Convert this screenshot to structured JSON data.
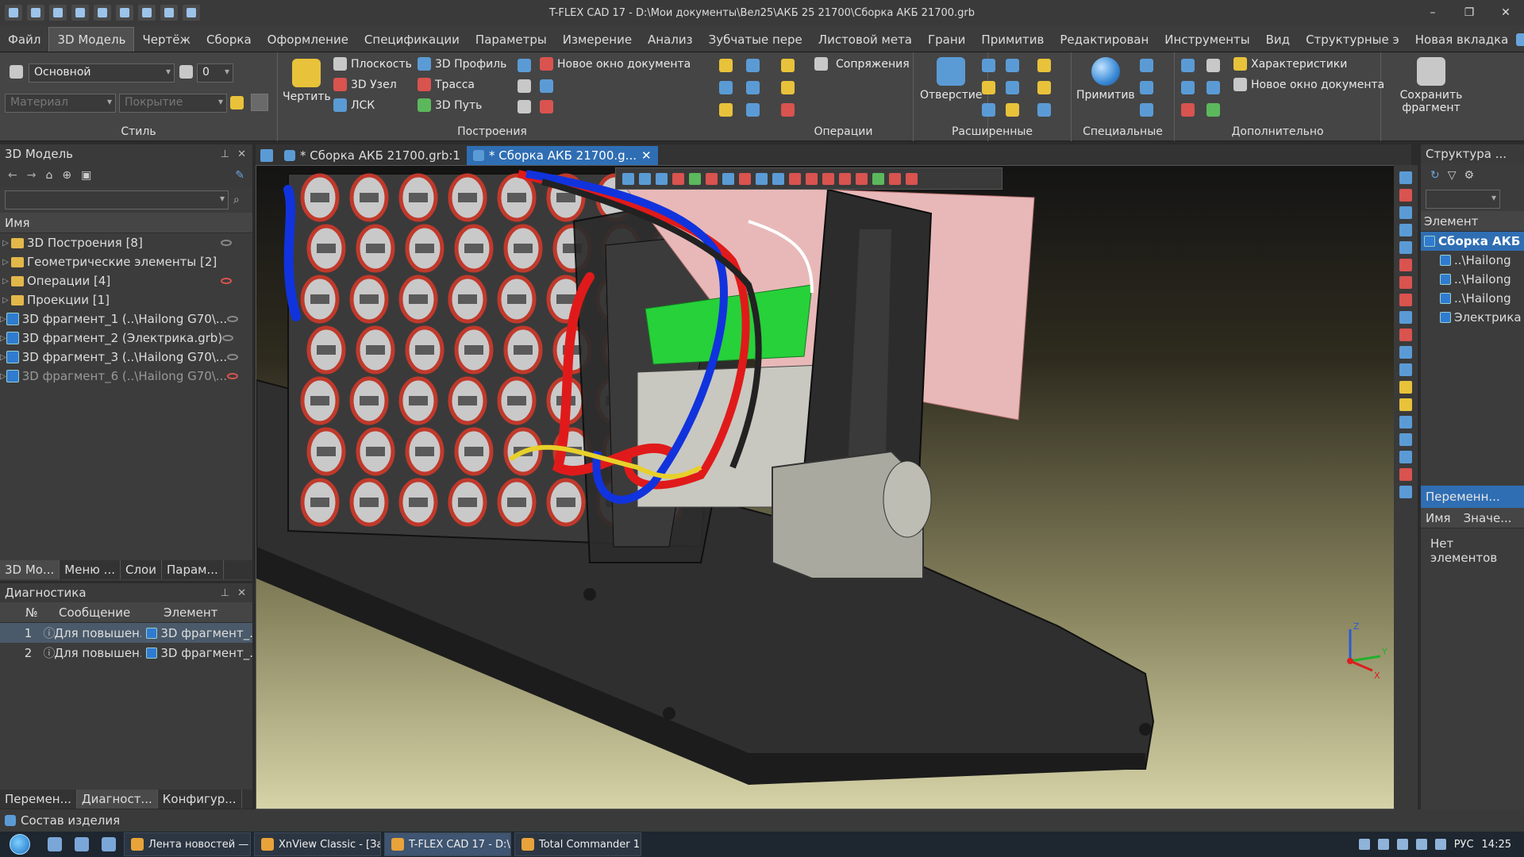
{
  "window": {
    "title": "T-FLEX CAD 17 - D:\\Мои документы\\Вел25\\АКБ 25 21700\\Сборка АКБ 21700.grb",
    "minimize": "–",
    "restore": "❐",
    "close": "✕"
  },
  "menu": {
    "tabs": [
      "Файл",
      "3D Модель",
      "Чертёж",
      "Сборка",
      "Оформление",
      "Спецификации",
      "Параметры",
      "Измерение",
      "Анализ",
      "Зубчатые пере",
      "Листовой мета",
      "Грани",
      "Примитив",
      "Редактирован",
      "Инструменты",
      "Вид",
      "Структурные э",
      "Новая вкладка"
    ],
    "active_index": 1
  },
  "ribbon": {
    "style": {
      "group_name": "Стиль",
      "layer_value": "Основной",
      "level_value": "0",
      "material_placeholder": "Материал",
      "coating_placeholder": "Покрытие"
    },
    "build": {
      "group_name": "Построения",
      "draw_label": "Чертить",
      "plane": "Плоскость",
      "node3d": "3D Узел",
      "lsk": "ЛСК",
      "profile3d": "3D Профиль",
      "route": "Трасса",
      "path3d": "3D Путь",
      "new_window": "Новое окно документа"
    },
    "operations": {
      "group_name": "Операции",
      "mates": "Сопряжения"
    },
    "extended": {
      "group_name": "Расширенные",
      "hole": "Отверстие"
    },
    "special": {
      "group_name": "Специальные",
      "primitive": "Примитив"
    },
    "additional": {
      "group_name": "Дополнительно",
      "characteristics": "Характеристики",
      "new_window": "Новое окно документа",
      "save_fragment": "Сохранить фрагмент"
    }
  },
  "model_panel": {
    "title": "3D Модель",
    "column": "Имя",
    "items": [
      {
        "label": "3D Построения [8]",
        "type": "folder",
        "eye": "on"
      },
      {
        "label": "Геометрические элементы [2]",
        "type": "folder",
        "eye": ""
      },
      {
        "label": "Операции [4]",
        "type": "folder",
        "eye": "hidden"
      },
      {
        "label": "Проекции [1]",
        "type": "folder",
        "eye": ""
      },
      {
        "label": "3D фрагмент_1 (..\\Hailong G70\\...",
        "type": "fragment",
        "eye": "on"
      },
      {
        "label": "3D фрагмент_2 (Электрика.grb)",
        "type": "fragment",
        "eye": "on"
      },
      {
        "label": "3D фрагмент_3 (..\\Hailong G70\\...",
        "type": "fragment",
        "eye": "on"
      },
      {
        "label": "3D фрагмент_6 (..\\Hailong G70\\...",
        "type": "fragment",
        "eye": "hidden",
        "dim": true
      }
    ],
    "tabs": [
      "3D Мо...",
      "Меню ...",
      "Слои",
      "Парам..."
    ]
  },
  "diagnostics": {
    "title": "Диагностика",
    "columns": [
      "№",
      "Сообщение",
      "Элемент"
    ],
    "rows": [
      {
        "n": "1",
        "message": "Для повышен...",
        "element": "3D фрагмент_..."
      },
      {
        "n": "2",
        "message": "Для повышен...",
        "element": "3D фрагмент_..."
      }
    ],
    "tabs": [
      "Перемен...",
      "Диагност...",
      "Конфигур..."
    ]
  },
  "documents": {
    "tabs": [
      "* Сборка АКБ 21700.grb:1",
      "* Сборка АКБ 21700.g..."
    ],
    "active_index": 1
  },
  "structure_panel": {
    "title": "Структура ...",
    "column": "Элемент",
    "items": [
      "Сборка АКБ",
      "..\\Hailong",
      "..\\Hailong",
      "..\\Hailong",
      "Электрика"
    ]
  },
  "variables_panel": {
    "title": "Переменн...",
    "columns": [
      "Имя",
      "Значе..."
    ],
    "empty": "Нет элементов"
  },
  "axes": {
    "x": "X",
    "y": "Y",
    "z": "Z"
  },
  "status": {
    "text": "Состав изделия"
  },
  "taskbar": {
    "tasks": [
      "Лента новостей — ...",
      "XnView Classic - [Зах...",
      "T-FLEX CAD 17 - D:\\...",
      "Total Commander 11...."
    ],
    "active_index": 2,
    "lang": "РУС",
    "time": "14:25"
  },
  "colors": {
    "accent": "#2f6eb3",
    "wire_red": "#e01a1a",
    "wire_blue": "#1133dd",
    "board_green": "#27d13a"
  }
}
